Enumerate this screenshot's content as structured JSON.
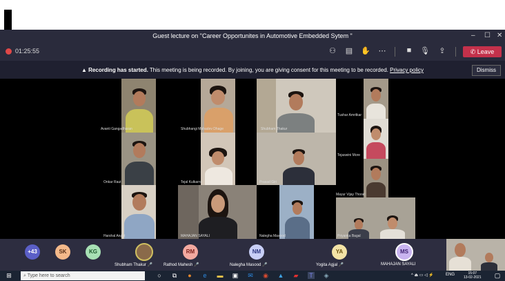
{
  "window": {
    "title": "Guest lecture on \"Career Opportunites in Automotive Embedded Sytem \""
  },
  "toolbar": {
    "timer": "01:25:55",
    "leave_label": "Leave"
  },
  "banner": {
    "bold": "Recording has started.",
    "text": "This meeting is being recorded. By joining, you are giving consent for this meeting to be recorded.",
    "link": "Privacy policy",
    "dismiss_label": "Dismiss"
  },
  "participants": [
    {
      "name": "Avanti Gangadharan"
    },
    {
      "name": "Shubhangi Mahadev Dhage"
    },
    {
      "name": "Shubham Thakur"
    },
    {
      "name": "Tushar Amritkar"
    },
    {
      "name": "Onkar Raut"
    },
    {
      "name": "Tejal Kulkarni"
    },
    {
      "name": "Prasad Giri"
    },
    {
      "name": "Tejaswini More"
    },
    {
      "name": "Mayur Vijay Thorat"
    },
    {
      "name": "Harshal Anpat"
    },
    {
      "name": "MAHAJAN SAYALI"
    },
    {
      "name": "Nalegha Masood"
    },
    {
      "name": "Priyanka Bagal"
    }
  ],
  "bottom_bar": {
    "overflow": "+43",
    "avatars": [
      {
        "initials": "SK",
        "color": "#f4b98a"
      },
      {
        "initials": "KG",
        "color": "#a7e0b4"
      },
      {
        "initials": "",
        "name": "Shubham Thakur"
      },
      {
        "initials": "RM",
        "color": "#f3a9a0",
        "name": "Rathod Mahesh"
      },
      {
        "initials": "NM",
        "color": "#c8cff6",
        "name": "Nalegha Masood"
      },
      {
        "initials": "YA",
        "color": "#f3e3a6",
        "name": "Yogita Agjal"
      },
      {
        "initials": "MS",
        "color": "#c9b4f0",
        "name": "MAHAJAN SAYALI"
      }
    ]
  },
  "taskbar": {
    "search_placeholder": "Type here to search",
    "lang": "ENG",
    "time": "15:07",
    "date": "13-02-2021"
  },
  "colors": {
    "accent": "#6264a7",
    "leave": "#c4314b",
    "bar": "#2a2b3c"
  }
}
